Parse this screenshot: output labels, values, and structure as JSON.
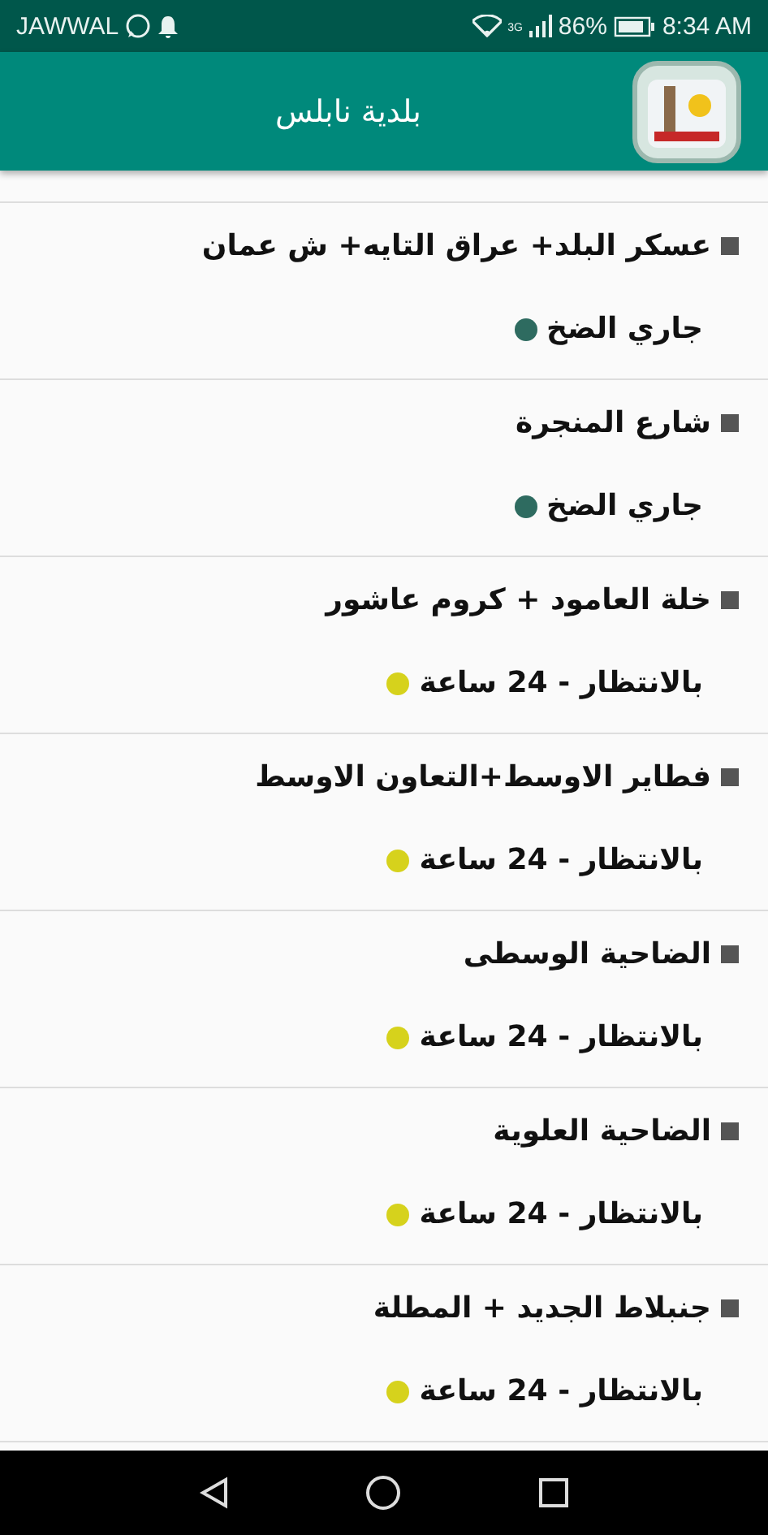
{
  "status_bar": {
    "carrier": "JAWWAL",
    "network": "3G",
    "battery": "86%",
    "time": "8:34 AM"
  },
  "app_bar": {
    "title": "بلدية نابلس"
  },
  "items": [
    {
      "name": "عسكر البلد+ عراق التايه+ ش عمان",
      "status": "جاري الضخ",
      "color": "#2e6b60"
    },
    {
      "name": "شارع المنجرة",
      "status": "جاري الضخ",
      "color": "#2e6b60"
    },
    {
      "name": "خلة العامود + كروم عاشور",
      "status": "بالانتظار - 24 ساعة",
      "color": "#d6d21c"
    },
    {
      "name": "فطاير الاوسط+التعاون الاوسط",
      "status": "بالانتظار - 24 ساعة",
      "color": "#d6d21c"
    },
    {
      "name": "الضاحية الوسطى",
      "status": "بالانتظار - 24 ساعة",
      "color": "#d6d21c"
    },
    {
      "name": "الضاحية العلوية",
      "status": "بالانتظار - 24 ساعة",
      "color": "#d6d21c"
    },
    {
      "name": "جنبلاط الجديد + المطلة",
      "status": "بالانتظار - 24 ساعة",
      "color": "#d6d21c"
    }
  ]
}
